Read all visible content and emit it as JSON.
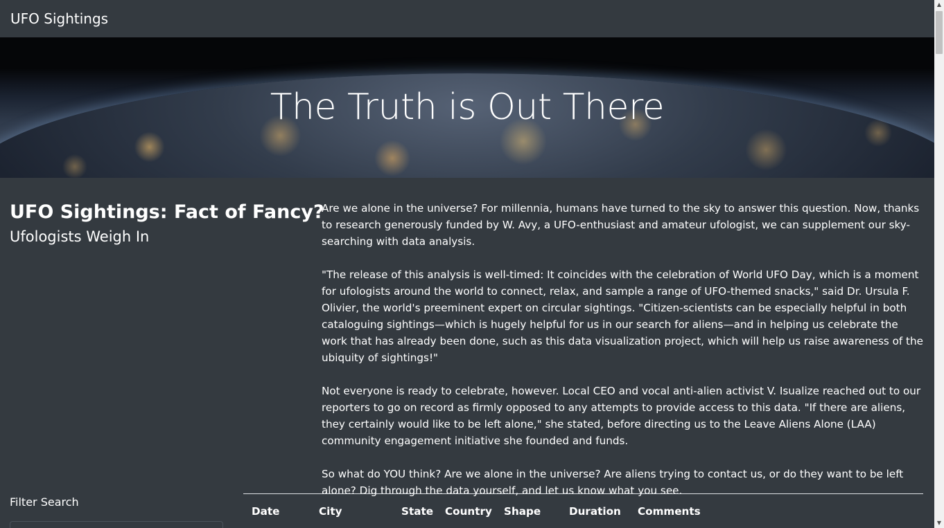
{
  "navbar": {
    "brand": "UFO Sightings"
  },
  "hero": {
    "title": "The Truth is Out There"
  },
  "article": {
    "title": "UFO Sightings: Fact of Fancy?",
    "subtitle": "Ufologists Weigh In",
    "paragraphs": [
      "Are we alone in the universe? For millennia, humans have turned to the sky to answer this question. Now, thanks to research generously funded by W. Avy, a UFO-enthusiast and amateur ufologist, we can supplement our sky-searching with data analysis.",
      "\"The release of this analysis is well-timed: It coincides with the celebration of World UFO Day, which is a moment for ufologists around the world to connect, relax, and sample a range of UFO-themed snacks,\" said Dr. Ursula F. Olivier, the world's preeminent expert on circular sightings. \"Citizen-scientists can be especially helpful in both cataloguing sightings—which is hugely helpful for us in our search for aliens—and in helping us celebrate the work that has already been done, such as this data visualization project, which will help us raise awareness of the ubiquity of sightings!\"",
      "Not everyone is ready to celebrate, however. Local CEO and vocal anti-alien activist V. Isualize reached out to our reporters to go on record as firmly opposed to any attempts to provide access to this data. \"If there are aliens, they certainly would like to be left alone,\" she stated, before directing us to the Leave Aliens Alone (LAA) community engagement initiative she founded and funds.",
      "So what do YOU think? Are we alone in the universe? Are aliens trying to contact us, or do they want to be left alone? Dig through the data yourself, and let us know what you see."
    ]
  },
  "filter": {
    "label": "Filter Search"
  },
  "table": {
    "columns": [
      "Date",
      "City",
      "State",
      "Country",
      "Shape",
      "Duration",
      "Comments"
    ]
  },
  "colors": {
    "background": "#343a40",
    "text": "#ffffff",
    "divider": "#dee2e6"
  }
}
